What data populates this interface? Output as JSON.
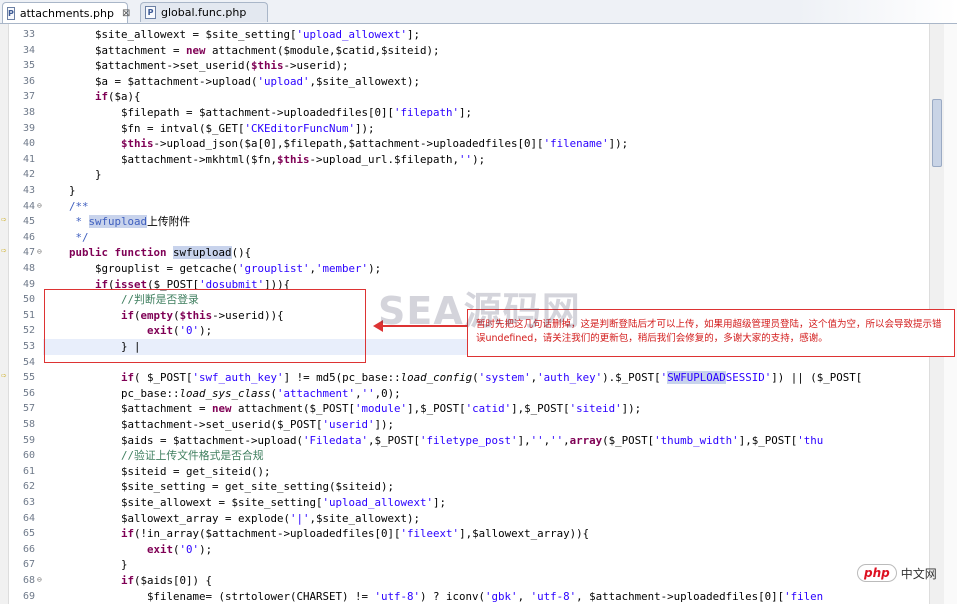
{
  "tabs": [
    {
      "name": "attachments.php",
      "icon": "php-file-icon",
      "active": true
    },
    {
      "name": "global.func.php",
      "icon": "php-file-icon",
      "active": false
    }
  ],
  "tab_icon_letter": "P",
  "close_glyph": "⊠",
  "lines": [
    {
      "n": "33",
      "html": "        $site_allowext = $site_setting[<span class=\"str\">'upload_allowext'</span>];"
    },
    {
      "n": "34",
      "html": "        $attachment = <span class=\"kw\">new</span> attachment($module,$catid,$siteid);"
    },
    {
      "n": "35",
      "html": "        $attachment-&gt;set_userid(<span class=\"kw\">$this</span>-&gt;userid);"
    },
    {
      "n": "36",
      "html": "        $a = $attachment-&gt;upload(<span class=\"str\">'upload'</span>,$site_allowext);"
    },
    {
      "n": "37",
      "html": "        <span class=\"kw\">if</span>($a){"
    },
    {
      "n": "38",
      "html": "            $filepath = $attachment-&gt;uploadedfiles[0][<span class=\"str\">'filepath'</span>];"
    },
    {
      "n": "39",
      "html": "            $fn = intval($_GET[<span class=\"str\">'CKEditorFuncNum'</span>]);"
    },
    {
      "n": "40",
      "html": "            <span class=\"kw\">$this</span>-&gt;upload_json($a[0],$filepath,$attachment-&gt;uploadedfiles[0][<span class=\"str\">'filename'</span>]);"
    },
    {
      "n": "41",
      "html": "            $attachment-&gt;mkhtml($fn,<span class=\"kw\">$this</span>-&gt;upload_url.$filepath,<span class=\"str\">''</span>);"
    },
    {
      "n": "42",
      "html": "        }"
    },
    {
      "n": "43",
      "html": "    }"
    },
    {
      "n": "44",
      "html": "    <span class=\"doc\">/**</span>",
      "fold": "⊖"
    },
    {
      "n": "45",
      "html": "<span class=\"doc\">     * <span class=\"hl\">swfupload</span></span><span style=\"font-family:'DejaVu Sans',sans-serif\">上传附件</span>",
      "marker": true
    },
    {
      "n": "46",
      "html": "<span class=\"doc\">     */</span>"
    },
    {
      "n": "47",
      "html": "    <span class=\"kw\">public function</span> <span class=\"hl\">swfupload</span>(){",
      "fold": "⊖",
      "marker": true
    },
    {
      "n": "48",
      "html": "        $grouplist = getcache(<span class=\"str\">'grouplist'</span>,<span class=\"str\">'member'</span>);"
    },
    {
      "n": "49",
      "html": "        <span class=\"kw\">if</span>(<span class=\"kw\">isset</span>($_POST[<span class=\"str\">'dosubmit'</span>])){"
    },
    {
      "n": "50",
      "html": "            <span class=\"cm\">//判断是否登录</span>"
    },
    {
      "n": "51",
      "html": "            <span class=\"kw\">if</span>(<span class=\"kw\">empty</span>(<span class=\"kw\">$this</span>-&gt;userid)){"
    },
    {
      "n": "52",
      "html": "                <span class=\"kw\">exit</span>(<span class=\"str\">'0'</span>);"
    },
    {
      "n": "53",
      "html": "            } |",
      "current": true
    },
    {
      "n": "54",
      "html": ""
    },
    {
      "n": "55",
      "html": "            <span class=\"kw\">if</span>( $_POST[<span class=\"str\">'swf_auth_key'</span>] != md5(pc_base::<span class=\"it\">load_config</span>(<span class=\"str\">'system'</span>,<span class=\"str\">'auth_key'</span>).$_POST[<span class=\"str\">'<span class=\"hl\">SWFUPLOAD</span>SESSID'</span>]) || ($_POST[",
      "marker": true
    },
    {
      "n": "56",
      "html": "            pc_base::<span class=\"it\">load_sys_class</span>(<span class=\"str\">'attachment'</span>,<span class=\"str\">''</span>,0);"
    },
    {
      "n": "57",
      "html": "            $attachment = <span class=\"kw\">new</span> attachment($_POST[<span class=\"str\">'module'</span>],$_POST[<span class=\"str\">'catid'</span>],$_POST[<span class=\"str\">'siteid'</span>]);"
    },
    {
      "n": "58",
      "html": "            $attachment-&gt;set_userid($_POST[<span class=\"str\">'userid'</span>]);"
    },
    {
      "n": "59",
      "html": "            $aids = $attachment-&gt;upload(<span class=\"str\">'Filedata'</span>,$_POST[<span class=\"str\">'filetype_post'</span>],<span class=\"str\">''</span>,<span class=\"str\">''</span>,<span class=\"kw\">array</span>($_POST[<span class=\"str\">'thumb_width'</span>],$_POST[<span class=\"str\">'thu</span>"
    },
    {
      "n": "60",
      "html": "            <span class=\"cm\">//验证上传文件格式是否合规</span>"
    },
    {
      "n": "61",
      "html": "            $siteid = get_siteid();"
    },
    {
      "n": "62",
      "html": "            $site_setting = get_site_setting($siteid);"
    },
    {
      "n": "63",
      "html": "            $site_allowext = $site_setting[<span class=\"str\">'upload_allowext'</span>];"
    },
    {
      "n": "64",
      "html": "            $allowext_array = explode(<span class=\"str\">'|'</span>,$site_allowext);"
    },
    {
      "n": "65",
      "html": "            <span class=\"kw\">if</span>(!in_array($attachment-&gt;uploadedfiles[0][<span class=\"str\">'fileext'</span>],$allowext_array)){"
    },
    {
      "n": "66",
      "html": "                <span class=\"kw\">exit</span>(<span class=\"str\">'0'</span>);"
    },
    {
      "n": "67",
      "html": "            }"
    },
    {
      "n": "68",
      "html": "            <span class=\"kw\">if</span>($aids[0]) {",
      "fold": "⊖"
    },
    {
      "n": "69",
      "html": "                $filename= (strtolower(CHARSET) != <span class=\"str\">'utf-8'</span>) ? iconv(<span class=\"str\">'gbk'</span>, <span class=\"str\">'utf-8'</span>, $attachment-&gt;uploadedfiles[0][<span class=\"str\">'filen</span>"
    }
  ],
  "annotation_note": "暂时先把这几句话删掉，这是判断登陆后才可以上传，如果用超级管理员登陆，这个值为空，所以会导致提示错误undefined，请关注我们的更新包，稍后我们会修复的，多谢大家的支持，感谢。",
  "watermark": "SEA源码网",
  "php_badge": {
    "logo": "php",
    "text": "中文网"
  },
  "colors": {
    "keyword": "#7f0055",
    "string": "#2a00ff",
    "comment": "#3f7f5f",
    "annotation": "#d21a1a"
  }
}
